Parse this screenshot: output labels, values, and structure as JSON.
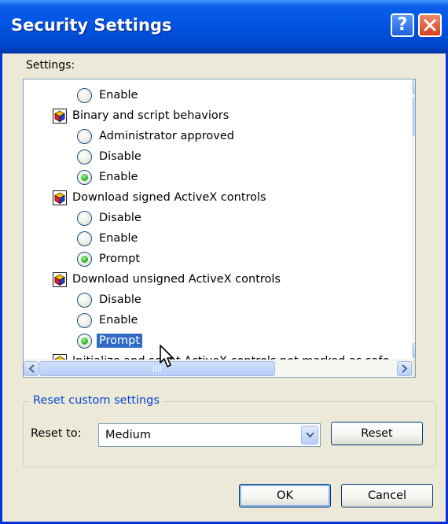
{
  "window": {
    "title": "Security Settings",
    "help_label": "?"
  },
  "settings": {
    "label": "Settings:",
    "rows": [
      {
        "type": "option",
        "label": "Enable",
        "checked": false
      },
      {
        "type": "category",
        "label": "Binary and script behaviors"
      },
      {
        "type": "option",
        "label": "Administrator approved",
        "checked": false
      },
      {
        "type": "option",
        "label": "Disable",
        "checked": false
      },
      {
        "type": "option",
        "label": "Enable",
        "checked": true
      },
      {
        "type": "category",
        "label": "Download signed ActiveX controls"
      },
      {
        "type": "option",
        "label": "Disable",
        "checked": false
      },
      {
        "type": "option",
        "label": "Enable",
        "checked": false
      },
      {
        "type": "option",
        "label": "Prompt",
        "checked": true
      },
      {
        "type": "category",
        "label": "Download unsigned ActiveX controls"
      },
      {
        "type": "option",
        "label": "Disable",
        "checked": false
      },
      {
        "type": "option",
        "label": "Enable",
        "checked": false
      },
      {
        "type": "option",
        "label": "Prompt",
        "checked": true,
        "selected": true
      },
      {
        "type": "category",
        "label": "Initialize and script ActiveX controls not marked as safe"
      }
    ]
  },
  "reset_group": {
    "title": "Reset custom settings",
    "reset_to_label": "Reset to:",
    "selected_level": "Medium",
    "reset_button": "Reset"
  },
  "dialog_buttons": {
    "ok": "OK",
    "cancel": "Cancel"
  },
  "colors": {
    "titlebar": "#0054e3",
    "selection": "#316ac5",
    "group_title": "#0046d5",
    "dialog_face": "#ece9d8"
  }
}
